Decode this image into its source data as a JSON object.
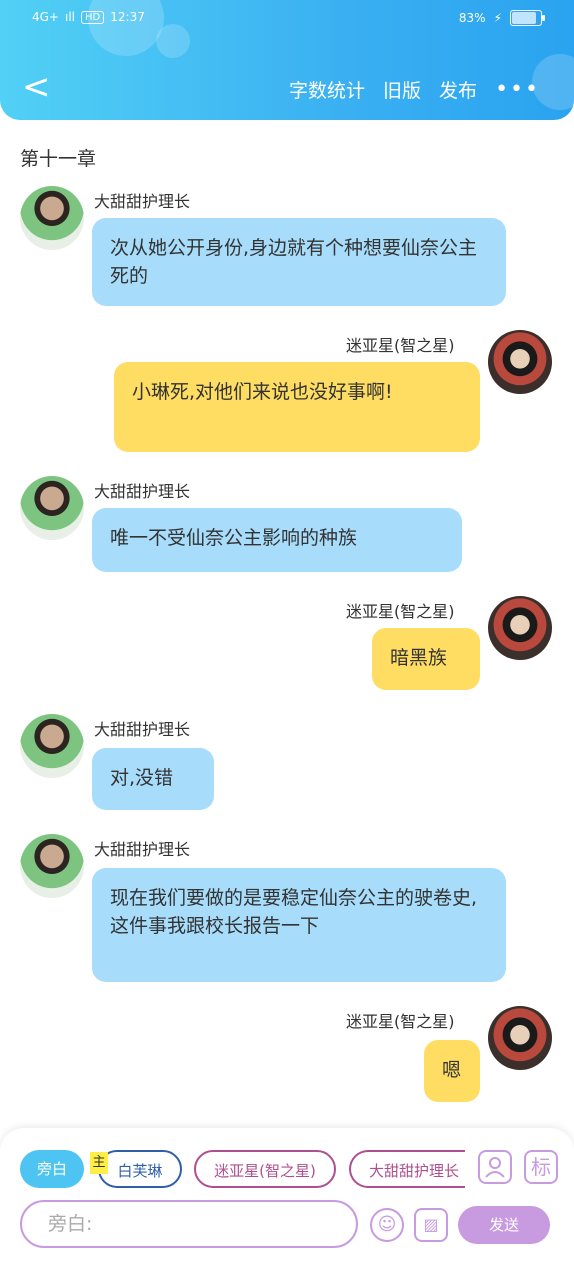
{
  "status_bar": {
    "network": "4G+",
    "signal": "ıll",
    "hd": "HD",
    "time": "12:37",
    "battery_percent": "83%"
  },
  "header": {
    "back": "<",
    "actions": [
      "字数统计",
      "旧版",
      "发布"
    ],
    "more": "•••"
  },
  "chapter": "第十一章",
  "messages": [
    {
      "side": "left",
      "name": "大甜甜护理长",
      "text": "次从她公开身份,身边就有个种想要仙奈公主死的"
    },
    {
      "side": "right",
      "name": "迷亚星(智之星)",
      "text": "小琳死,对他们来说也没好事啊!"
    },
    {
      "side": "left",
      "name": "大甜甜护理长",
      "text": "唯一不受仙奈公主影响的种族"
    },
    {
      "side": "right",
      "name": "迷亚星(智之星)",
      "text": "暗黑族"
    },
    {
      "side": "left",
      "name": "大甜甜护理长",
      "text": "对,没错"
    },
    {
      "side": "left",
      "name": "大甜甜护理长",
      "text": "现在我们要做的是要稳定仙奈公主的驶卷史,这件事我跟校长报告一下"
    },
    {
      "side": "right",
      "name": "迷亚星(智之星)",
      "text": "嗯"
    }
  ],
  "roles": [
    "旁白",
    "白芙琳",
    "迷亚星(智之星)",
    "大甜甜护理长"
  ],
  "main_tag": "主",
  "icons": {
    "profile": "user-icon",
    "tag": "标",
    "emoji": "☺",
    "image": "▨"
  },
  "input": {
    "placeholder": "旁白:"
  },
  "send_label": "发送",
  "colors": {
    "accent": "#3ab0f2",
    "blue_bubble": "#a7dcfb",
    "yellow_bubble": "#ffdd63",
    "purple": "#c89ae0"
  }
}
